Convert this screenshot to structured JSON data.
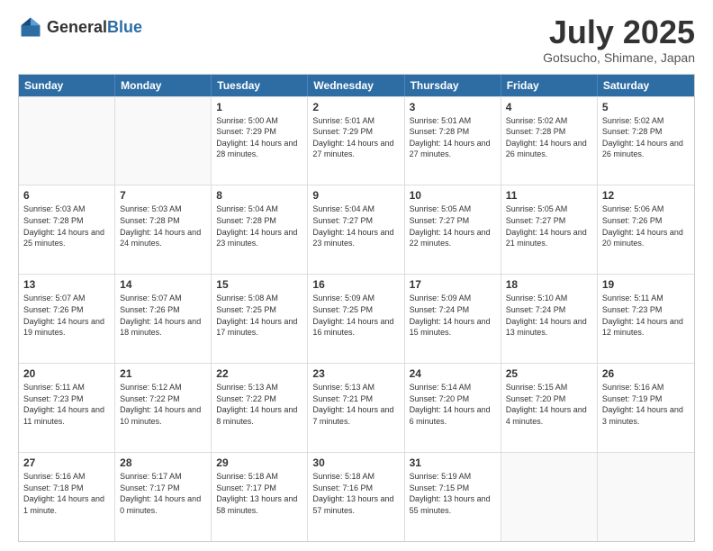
{
  "header": {
    "logo_general": "General",
    "logo_blue": "Blue",
    "month": "July 2025",
    "location": "Gotsucho, Shimane, Japan"
  },
  "days_of_week": [
    "Sunday",
    "Monday",
    "Tuesday",
    "Wednesday",
    "Thursday",
    "Friday",
    "Saturday"
  ],
  "weeks": [
    [
      {
        "day": "",
        "empty": true
      },
      {
        "day": "",
        "empty": true
      },
      {
        "day": "1",
        "sunrise": "5:00 AM",
        "sunset": "7:29 PM",
        "daylight": "14 hours and 28 minutes."
      },
      {
        "day": "2",
        "sunrise": "5:01 AM",
        "sunset": "7:29 PM",
        "daylight": "14 hours and 27 minutes."
      },
      {
        "day": "3",
        "sunrise": "5:01 AM",
        "sunset": "7:28 PM",
        "daylight": "14 hours and 27 minutes."
      },
      {
        "day": "4",
        "sunrise": "5:02 AM",
        "sunset": "7:28 PM",
        "daylight": "14 hours and 26 minutes."
      },
      {
        "day": "5",
        "sunrise": "5:02 AM",
        "sunset": "7:28 PM",
        "daylight": "14 hours and 26 minutes."
      }
    ],
    [
      {
        "day": "6",
        "sunrise": "5:03 AM",
        "sunset": "7:28 PM",
        "daylight": "14 hours and 25 minutes."
      },
      {
        "day": "7",
        "sunrise": "5:03 AM",
        "sunset": "7:28 PM",
        "daylight": "14 hours and 24 minutes."
      },
      {
        "day": "8",
        "sunrise": "5:04 AM",
        "sunset": "7:28 PM",
        "daylight": "14 hours and 23 minutes."
      },
      {
        "day": "9",
        "sunrise": "5:04 AM",
        "sunset": "7:27 PM",
        "daylight": "14 hours and 23 minutes."
      },
      {
        "day": "10",
        "sunrise": "5:05 AM",
        "sunset": "7:27 PM",
        "daylight": "14 hours and 22 minutes."
      },
      {
        "day": "11",
        "sunrise": "5:05 AM",
        "sunset": "7:27 PM",
        "daylight": "14 hours and 21 minutes."
      },
      {
        "day": "12",
        "sunrise": "5:06 AM",
        "sunset": "7:26 PM",
        "daylight": "14 hours and 20 minutes."
      }
    ],
    [
      {
        "day": "13",
        "sunrise": "5:07 AM",
        "sunset": "7:26 PM",
        "daylight": "14 hours and 19 minutes."
      },
      {
        "day": "14",
        "sunrise": "5:07 AM",
        "sunset": "7:26 PM",
        "daylight": "14 hours and 18 minutes."
      },
      {
        "day": "15",
        "sunrise": "5:08 AM",
        "sunset": "7:25 PM",
        "daylight": "14 hours and 17 minutes."
      },
      {
        "day": "16",
        "sunrise": "5:09 AM",
        "sunset": "7:25 PM",
        "daylight": "14 hours and 16 minutes."
      },
      {
        "day": "17",
        "sunrise": "5:09 AM",
        "sunset": "7:24 PM",
        "daylight": "14 hours and 15 minutes."
      },
      {
        "day": "18",
        "sunrise": "5:10 AM",
        "sunset": "7:24 PM",
        "daylight": "14 hours and 13 minutes."
      },
      {
        "day": "19",
        "sunrise": "5:11 AM",
        "sunset": "7:23 PM",
        "daylight": "14 hours and 12 minutes."
      }
    ],
    [
      {
        "day": "20",
        "sunrise": "5:11 AM",
        "sunset": "7:23 PM",
        "daylight": "14 hours and 11 minutes."
      },
      {
        "day": "21",
        "sunrise": "5:12 AM",
        "sunset": "7:22 PM",
        "daylight": "14 hours and 10 minutes."
      },
      {
        "day": "22",
        "sunrise": "5:13 AM",
        "sunset": "7:22 PM",
        "daylight": "14 hours and 8 minutes."
      },
      {
        "day": "23",
        "sunrise": "5:13 AM",
        "sunset": "7:21 PM",
        "daylight": "14 hours and 7 minutes."
      },
      {
        "day": "24",
        "sunrise": "5:14 AM",
        "sunset": "7:20 PM",
        "daylight": "14 hours and 6 minutes."
      },
      {
        "day": "25",
        "sunrise": "5:15 AM",
        "sunset": "7:20 PM",
        "daylight": "14 hours and 4 minutes."
      },
      {
        "day": "26",
        "sunrise": "5:16 AM",
        "sunset": "7:19 PM",
        "daylight": "14 hours and 3 minutes."
      }
    ],
    [
      {
        "day": "27",
        "sunrise": "5:16 AM",
        "sunset": "7:18 PM",
        "daylight": "14 hours and 1 minute."
      },
      {
        "day": "28",
        "sunrise": "5:17 AM",
        "sunset": "7:17 PM",
        "daylight": "14 hours and 0 minutes."
      },
      {
        "day": "29",
        "sunrise": "5:18 AM",
        "sunset": "7:17 PM",
        "daylight": "13 hours and 58 minutes."
      },
      {
        "day": "30",
        "sunrise": "5:18 AM",
        "sunset": "7:16 PM",
        "daylight": "13 hours and 57 minutes."
      },
      {
        "day": "31",
        "sunrise": "5:19 AM",
        "sunset": "7:15 PM",
        "daylight": "13 hours and 55 minutes."
      },
      {
        "day": "",
        "empty": true
      },
      {
        "day": "",
        "empty": true
      }
    ]
  ]
}
